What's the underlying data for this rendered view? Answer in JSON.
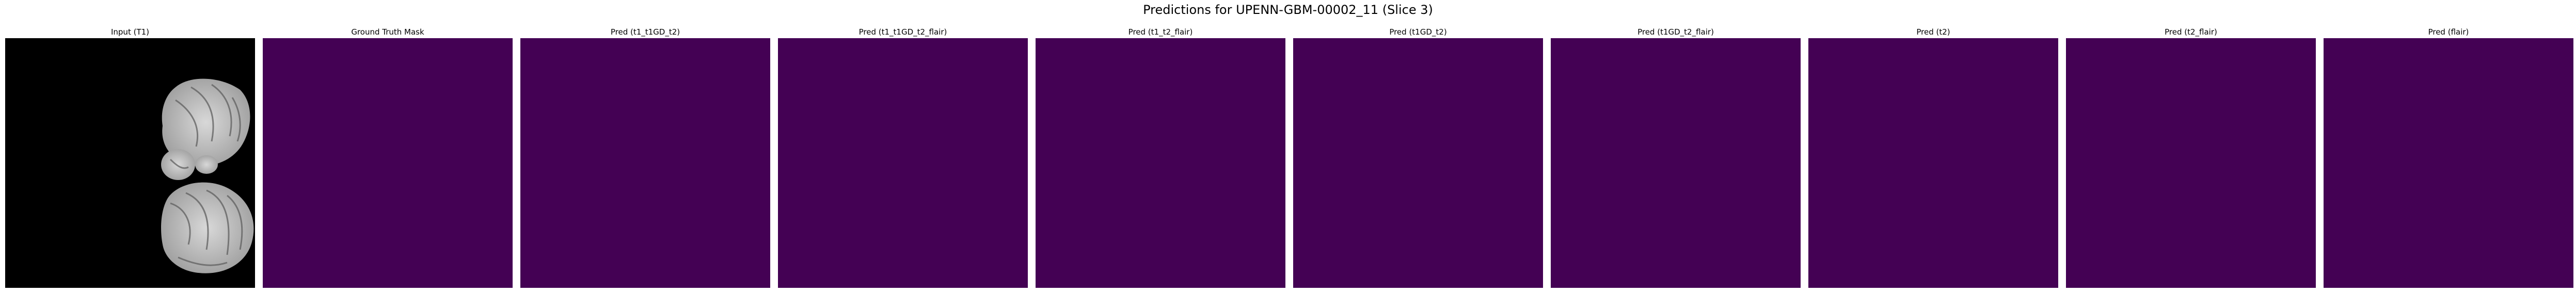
{
  "figure": {
    "title": "Predictions for UPENN-GBM-00002_11 (Slice 3)",
    "mask_color": "#440154",
    "panels": [
      {
        "title": "Input (T1)",
        "kind": "mri"
      },
      {
        "title": "Ground Truth Mask",
        "kind": "mask"
      },
      {
        "title": "Pred (t1_t1GD_t2)",
        "kind": "mask"
      },
      {
        "title": "Pred (t1_t1GD_t2_flair)",
        "kind": "mask"
      },
      {
        "title": "Pred (t1_t2_flair)",
        "kind": "mask"
      },
      {
        "title": "Pred (t1GD_t2)",
        "kind": "mask"
      },
      {
        "title": "Pred (t1GD_t2_flair)",
        "kind": "mask"
      },
      {
        "title": "Pred (t2)",
        "kind": "mask"
      },
      {
        "title": "Pred (t2_flair)",
        "kind": "mask"
      },
      {
        "title": "Pred (flair)",
        "kind": "mask"
      }
    ]
  }
}
